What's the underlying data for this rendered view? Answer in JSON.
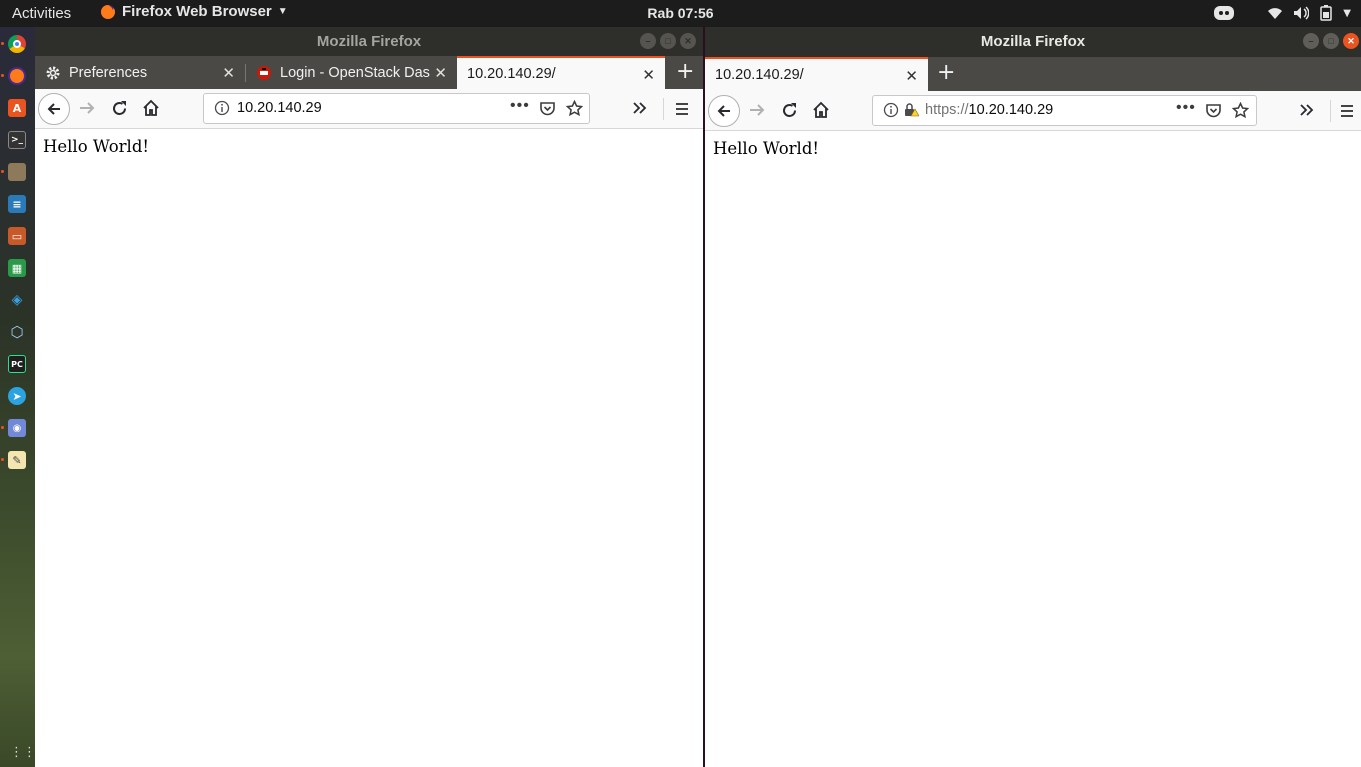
{
  "topbar": {
    "activities": "Activities",
    "app_name": "Firefox Web Browser",
    "clock": "Rab 07:56",
    "tray_icons": [
      "discord-icon",
      "wifi-icon",
      "volume-icon",
      "battery-icon",
      "caret-down-icon"
    ]
  },
  "dock": {
    "apps": [
      "chrome",
      "firefox",
      "software-center",
      "terminal",
      "files",
      "writer",
      "impress",
      "calc",
      "vscode",
      "virtualbox",
      "pycharm",
      "telegram",
      "discord",
      "text-editor"
    ],
    "show_apps": "show-applications-icon"
  },
  "window_left": {
    "title": "Mozilla Firefox",
    "tabs": [
      {
        "label": "Preferences",
        "icon": "gear-icon",
        "active": false
      },
      {
        "label": "Login - OpenStack Dashboard",
        "icon": "openstack-icon",
        "active": false
      },
      {
        "label": "10.20.140.29/",
        "icon": "",
        "active": true
      }
    ],
    "url": "10.20.140.29",
    "content": "Hello World!"
  },
  "window_right": {
    "title": "Mozilla Firefox",
    "tabs": [
      {
        "label": "10.20.140.29/",
        "active": true
      }
    ],
    "url_scheme": "https://",
    "url_host": "10.20.140.29",
    "content": "Hello World!"
  },
  "colors": {
    "accent": "#e95420",
    "topbar": "#1c1c1c",
    "titlebar": "#2e2e2b",
    "tabstrip": "#4a4946",
    "toolbar": "#f9f9fa"
  }
}
